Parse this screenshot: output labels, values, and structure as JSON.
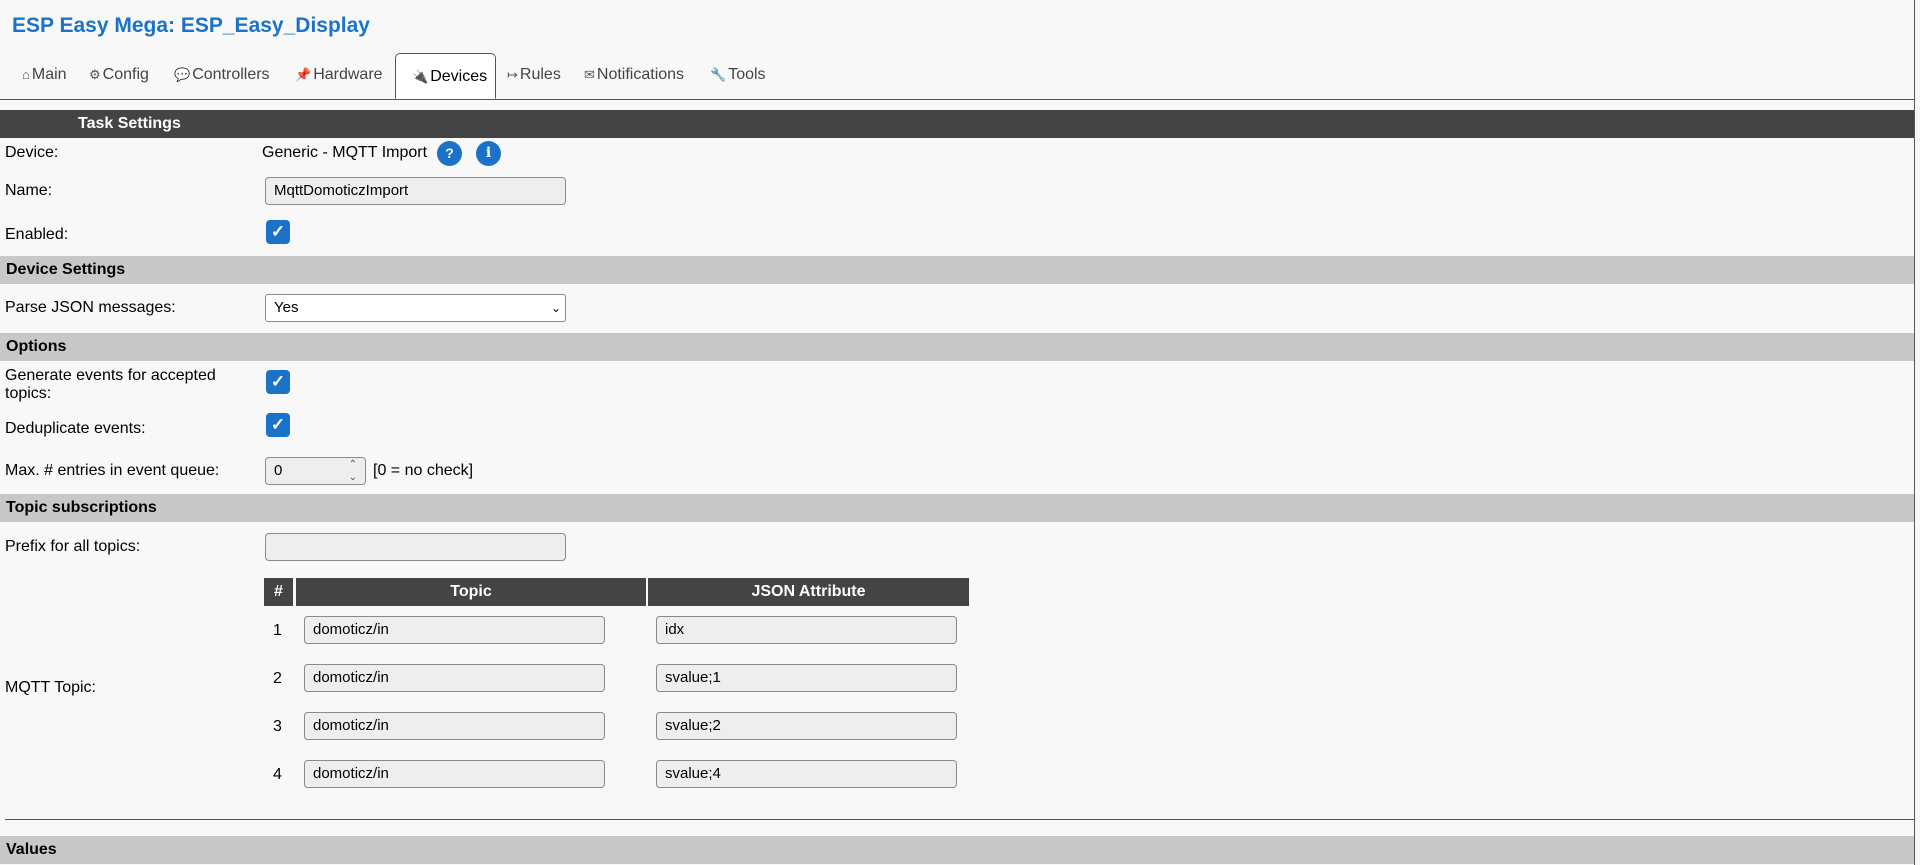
{
  "app": {
    "title": "ESP Easy Mega: ESP_Easy_Display"
  },
  "tabs": [
    {
      "label": "Main",
      "icon": "⌂"
    },
    {
      "label": "Config",
      "icon": "⚙"
    },
    {
      "label": "Controllers",
      "icon": "💬"
    },
    {
      "label": "Hardware",
      "icon": "📌"
    },
    {
      "label": "Devices",
      "icon": "🔌"
    },
    {
      "label": "Rules",
      "icon": "↦"
    },
    {
      "label": "Notifications",
      "icon": "✉"
    },
    {
      "label": "Tools",
      "icon": "🔧"
    }
  ],
  "task": {
    "header": "Task Settings",
    "device_label": "Device:",
    "device_value": "Generic - MQTT Import",
    "help_q": "?",
    "help_i": "i",
    "name_label": "Name:",
    "name_value": "MqttDomoticzImport",
    "enabled_label": "Enabled:"
  },
  "device_settings": {
    "header": "Device Settings",
    "parse_label": "Parse JSON messages:",
    "parse_value": "Yes"
  },
  "options": {
    "header": "Options",
    "gen_events_label": "Generate events for accepted topics:",
    "dedup_label": "Deduplicate events:",
    "max_entries_label": "Max. # entries in event queue:",
    "max_entries_value": "0",
    "max_entries_note": "[0 = no check]"
  },
  "topics": {
    "header": "Topic subscriptions",
    "prefix_label": "Prefix for all topics:",
    "prefix_value": "",
    "mqtt_label": "MQTT Topic:",
    "col_num": "#",
    "col_topic": "Topic",
    "col_attr": "JSON Attribute",
    "rows": [
      {
        "num": "1",
        "topic": "domoticz/in",
        "attr": "idx"
      },
      {
        "num": "2",
        "topic": "domoticz/in",
        "attr": "svalue;1"
      },
      {
        "num": "3",
        "topic": "domoticz/in",
        "attr": "svalue;2"
      },
      {
        "num": "4",
        "topic": "domoticz/in",
        "attr": "svalue;4"
      }
    ]
  },
  "values": {
    "header": "Values"
  }
}
